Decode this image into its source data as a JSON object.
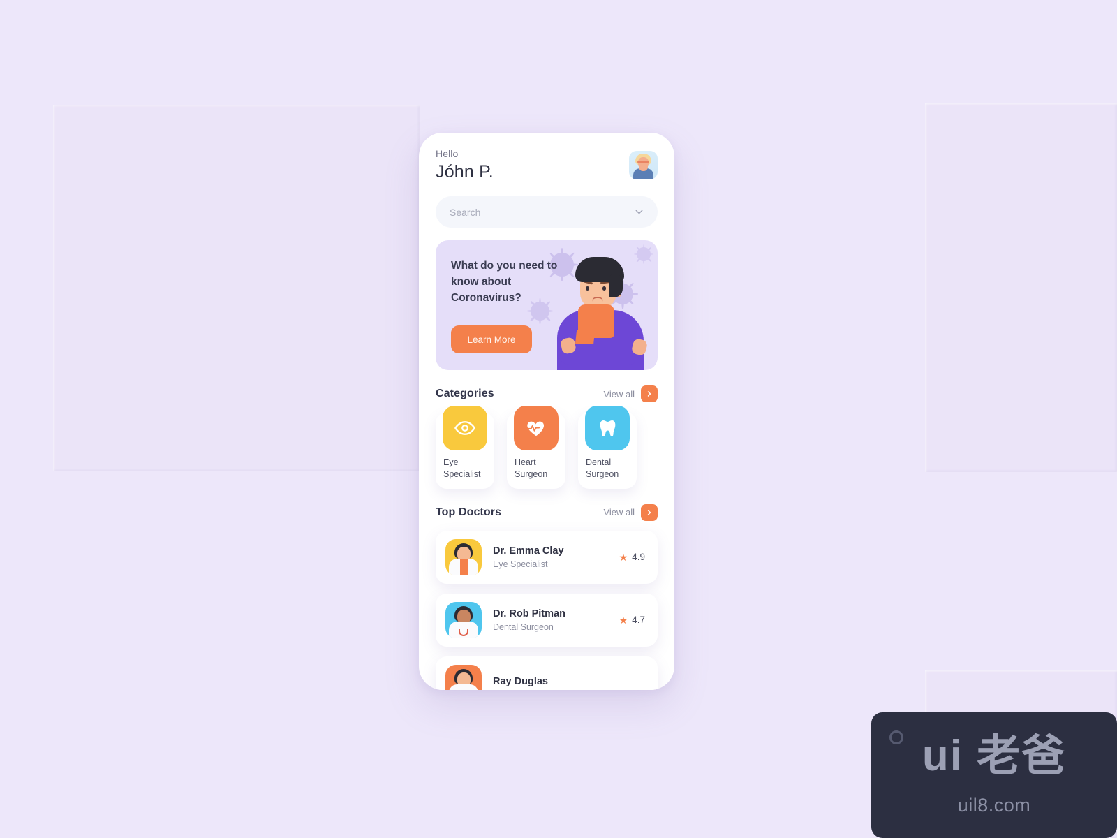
{
  "app": {
    "background_color": "#EDE7FA",
    "accent_color": "#F4804B"
  },
  "header": {
    "greeting": "Hello",
    "user_name": "Jóhn P.",
    "avatar_icon": "user-avatar-icon"
  },
  "search": {
    "value": "",
    "placeholder": "Search",
    "chevron_icon": "chevron-down-icon"
  },
  "banner": {
    "title": "What do you need to know about Coronavirus?",
    "button_label": "Learn More",
    "background_color": "#E5DEF9",
    "button_color": "#F4804B",
    "illustration": "man-with-scarf-and-virus-icon"
  },
  "categories_section": {
    "title": "Categories",
    "view_all_label": "View all",
    "view_all_icon": "chevron-right-icon",
    "items": [
      {
        "label": "Eye\nSpecialist",
        "label_line1": "Eye",
        "label_line2": "Specialist",
        "icon": "eye-icon",
        "color": "#F9C93D"
      },
      {
        "label": "Heart\nSurgeon",
        "label_line1": "Heart",
        "label_line2": "Surgeon",
        "icon": "heart-pulse-icon",
        "color": "#F4804B"
      },
      {
        "label": "Dental\nSurgeon",
        "label_line1": "Dental",
        "label_line2": "Surgeon",
        "icon": "tooth-icon",
        "color": "#4FC6EE"
      }
    ]
  },
  "doctors_section": {
    "title": "Top Doctors",
    "view_all_label": "View all",
    "view_all_icon": "chevron-right-icon",
    "items": [
      {
        "name": "Dr. Emma Clay",
        "specialty": "Eye Specialist",
        "rating": "4.9",
        "avatar_color": "#F9C93D",
        "avatar_icon": "doctor-female-avatar-icon"
      },
      {
        "name": "Dr. Rob Pitman",
        "specialty": "Dental Surgeon",
        "rating": "4.7",
        "avatar_color": "#4FC6EE",
        "avatar_icon": "doctor-male-avatar-icon"
      },
      {
        "name": "Ray Duglas",
        "specialty": "",
        "rating": "",
        "avatar_color": "#F4804B",
        "avatar_icon": "doctor-male-avatar-icon"
      }
    ],
    "star_icon": "star-icon"
  },
  "watermark": {
    "logo": "ui 老爸",
    "url": "uil8.com",
    "circle_icon": "circle-icon",
    "background_color": "#2C2F41"
  }
}
